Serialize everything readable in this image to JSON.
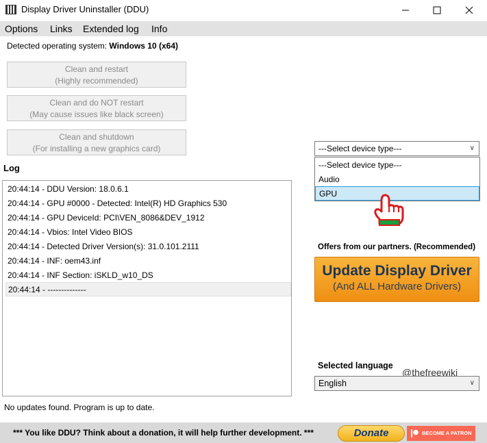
{
  "window": {
    "title": "Display Driver Uninstaller (DDU)",
    "minimize_icon": "minimize-icon",
    "maximize_icon": "maximize-icon",
    "close_icon": "close-icon"
  },
  "menu": {
    "items": [
      "Options",
      "Links",
      "Extended log",
      "Info"
    ]
  },
  "os": {
    "label": "Detected operating system:",
    "value": "Windows 10 (x64)"
  },
  "actions": [
    {
      "line1": "Clean and restart",
      "line2": "(Highly recommended)"
    },
    {
      "line1": "Clean and do NOT restart",
      "line2": "(May cause issues like black screen)"
    },
    {
      "line1": "Clean and shutdown",
      "line2": "(For installing a new graphics card)"
    }
  ],
  "log": {
    "label": "Log",
    "lines": [
      "20:44:14 - DDU Version: 18.0.6.1",
      "20:44:14 - GPU #0000 - Detected: Intel(R) HD Graphics 530",
      "20:44:14 - GPU DeviceId: PCI\\VEN_8086&DEV_1912",
      "20:44:14 - Vbios: Intel Video BIOS",
      "20:44:14 - Detected Driver Version(s): 31.0.101.2111",
      "20:44:14 - INF: oem43.inf",
      "20:44:14 - INF Section: iSKLD_w10_DS",
      "20:44:14 - --------------"
    ]
  },
  "status": "No updates found. Program is up to date.",
  "device_type": {
    "selected": "---Select device type---",
    "options": [
      "---Select device type---",
      "Audio",
      "GPU"
    ],
    "highlighted_index": 2
  },
  "partners": {
    "label": "Offers from our partners. (Recommended)",
    "button_main": "Update Display Driver",
    "button_sub": "(And ALL Hardware Drivers)"
  },
  "language": {
    "label": "Selected language",
    "selected": "English"
  },
  "watermark": "@thefreewiki",
  "footer": {
    "donate_text": "*** You like DDU? Think about a donation, it will help further development. ***",
    "donate_button": "Donate",
    "patron_button": "BECOME A PATRON"
  },
  "colors": {
    "menu_bg": "#e2e2e2",
    "update_button": "#f2a025",
    "patron": "#f96854",
    "highlight": "#cde8f7"
  }
}
